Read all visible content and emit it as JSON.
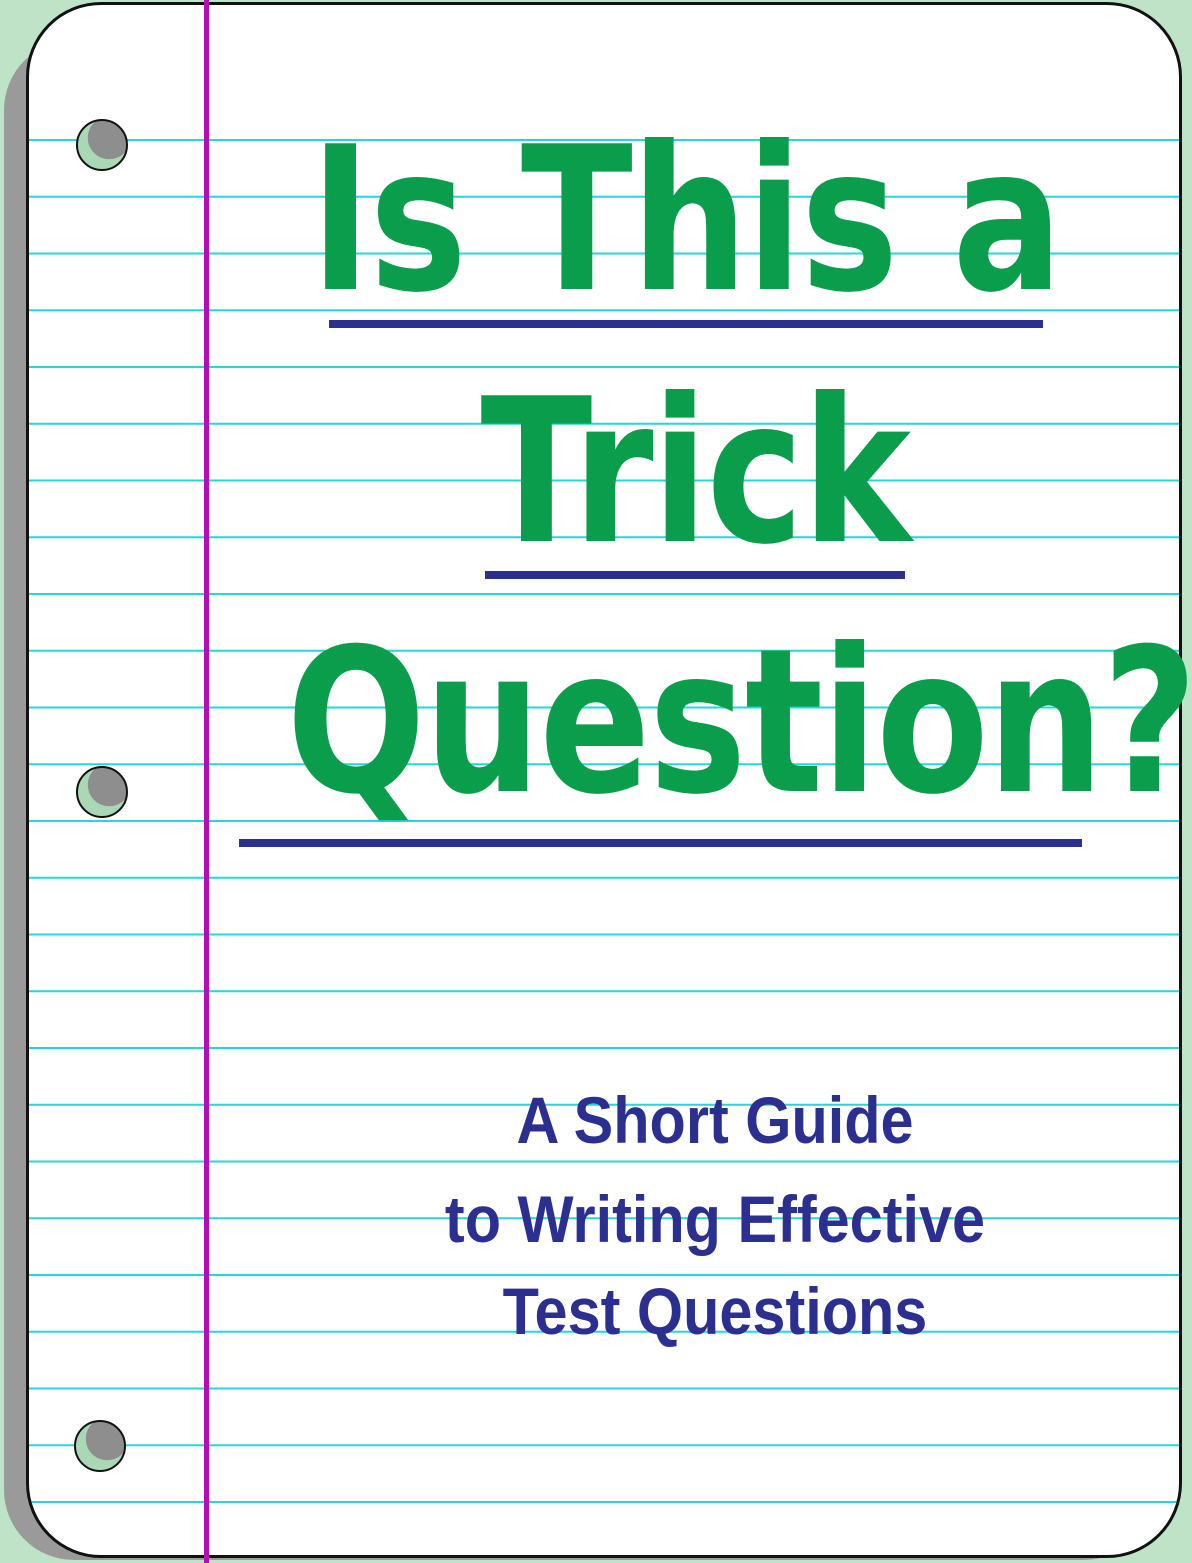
{
  "title": {
    "line1": "Is This a",
    "line2": "Trick",
    "line3": "Question?"
  },
  "subtitle": {
    "line1": "A Short Guide",
    "line2": "to Writing Effective",
    "line3": "Test Questions"
  },
  "colors": {
    "background": "#bfe3c7",
    "paper": "#ffffff",
    "rule_lines": "#27d6d6",
    "margin_line": "#b40fb4",
    "title_text": "#0a9e4c",
    "title_underline": "#2b2f8f",
    "subtitle_text": "#2b2f8f"
  }
}
